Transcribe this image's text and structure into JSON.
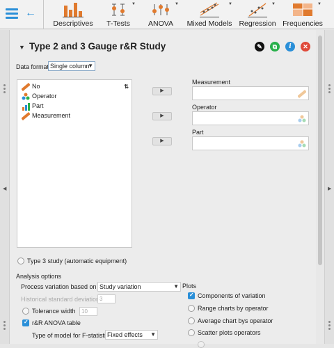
{
  "toolbar": {
    "items": [
      {
        "label": "Descriptives"
      },
      {
        "label": "T-Tests"
      },
      {
        "label": "ANOVA"
      },
      {
        "label": "Mixed Models"
      },
      {
        "label": "Regression"
      },
      {
        "label": "Frequencies"
      }
    ]
  },
  "header": {
    "title": "Type 2 and 3 Gauge r&R Study"
  },
  "data_format": {
    "label": "Data format",
    "value": "Single column"
  },
  "variables": [
    {
      "name": "No",
      "icon": "scale-ruler-icon"
    },
    {
      "name": "Operator",
      "icon": "nominal-people-icon"
    },
    {
      "name": "Part",
      "icon": "ordinal-bars-icon"
    },
    {
      "name": "Measurement",
      "icon": "scale-ruler-icon"
    }
  ],
  "targets": [
    {
      "label": "Measurement"
    },
    {
      "label": "Operator"
    },
    {
      "label": "Part"
    }
  ],
  "type3": {
    "label": "Type 3 study (automatic equipment)",
    "checked": false
  },
  "analysis": {
    "title": "Analysis options",
    "process_label": "Process variation based on",
    "process_value": "Study variation",
    "hist_label": "Historical standard deviation:",
    "hist_value": "3",
    "tol_label": "Tolerance width",
    "tol_value": "10",
    "anova_label": "r&R ANOVA table",
    "anova_checked": true,
    "model_label": "Type of model for F-statistic",
    "model_value": "Fixed effects"
  },
  "plots": {
    "title": "Plots",
    "items": [
      {
        "label": "Components of variation",
        "checked": true
      },
      {
        "label": "Range charts by operator",
        "checked": false
      },
      {
        "label": "Average chart bys operator",
        "checked": false
      },
      {
        "label": "Scatter plots operators",
        "checked": false
      }
    ]
  },
  "colors": {
    "accent": "#2a8fd8",
    "toolbar_orange": "#e07a2e",
    "close_red": "#e04a3a",
    "green": "#27b04a"
  }
}
